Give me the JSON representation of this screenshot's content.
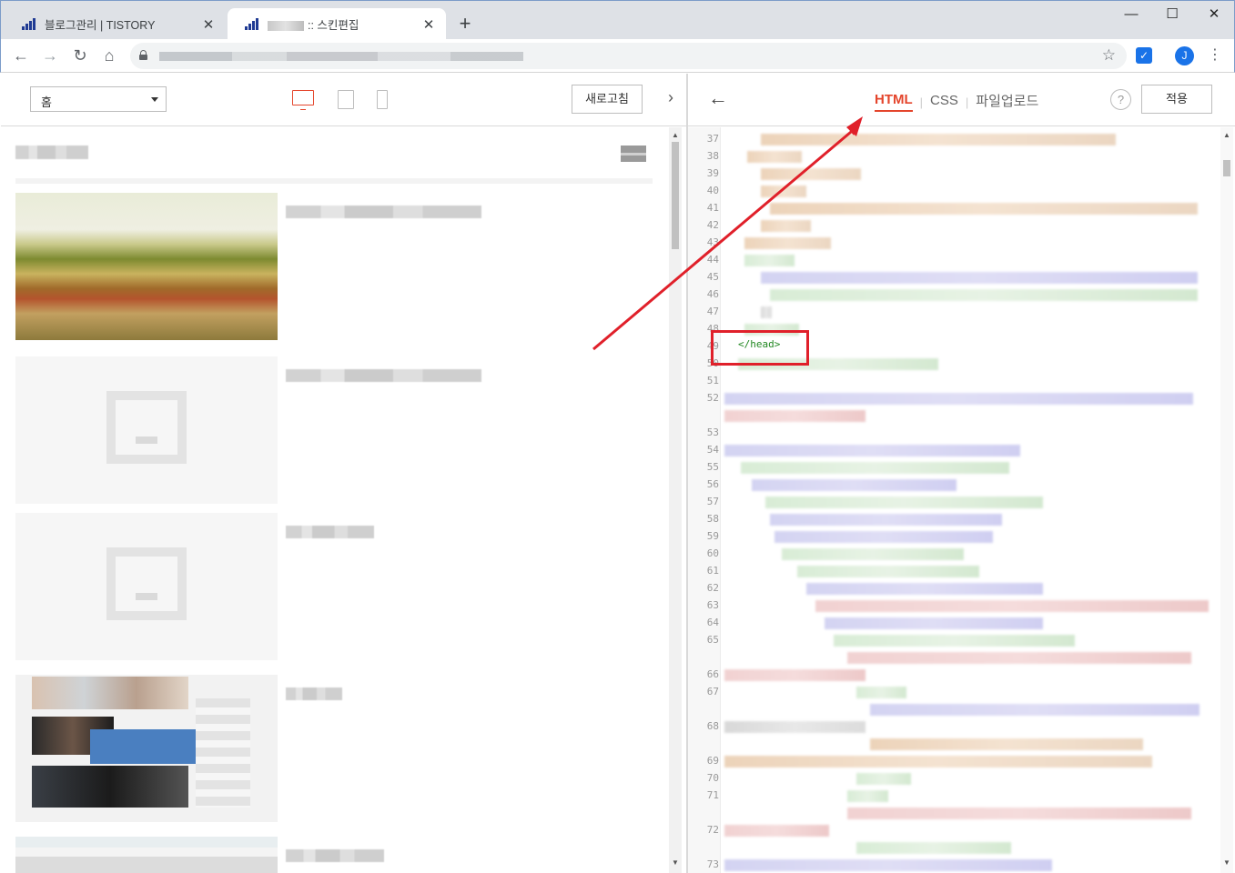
{
  "browser": {
    "tabs": [
      {
        "title": "블로그관리 | TISTORY",
        "active": false
      },
      {
        "title": ":: 스킨편집",
        "active": true
      }
    ],
    "new_tab_symbol": "+",
    "tab_close_symbol": "✕",
    "window_controls": {
      "minimize": "—",
      "maximize": "☐",
      "close": "✕"
    },
    "profile_initial": "J",
    "icons": [
      "back-icon",
      "forward-icon",
      "reload-icon",
      "home-icon",
      "lock-icon",
      "star-icon",
      "extension-icon",
      "menu-icon"
    ]
  },
  "preview": {
    "page_select": "홈",
    "refresh_label": "새로고침",
    "collapse_symbol": "›",
    "devices": [
      "desktop",
      "tablet",
      "mobile"
    ],
    "active_device": "desktop"
  },
  "code_editor": {
    "back_symbol": "←",
    "tabs": [
      {
        "label": "HTML",
        "active": true
      },
      {
        "label": "CSS",
        "active": false
      },
      {
        "label": "파일업로드",
        "active": false
      }
    ],
    "tab_separator": "|",
    "help_symbol": "?",
    "apply_label": "적용",
    "line_numbers": [
      "37",
      "38",
      "39",
      "40",
      "41",
      "42",
      "43",
      "44",
      "45",
      "46",
      "47",
      "48",
      "49",
      "50",
      "51",
      "52",
      "53",
      "54",
      "55",
      "56",
      "57",
      "58",
      "59",
      "60",
      "61",
      "62",
      "63",
      "64",
      "65",
      "66",
      "67",
      "68",
      "69",
      "70",
      "71",
      "72",
      "73"
    ],
    "highlighted_code": "</head>"
  },
  "colors": {
    "accent": "#e4452c",
    "annotation": "#e0202a",
    "tag_green": "#228822"
  }
}
